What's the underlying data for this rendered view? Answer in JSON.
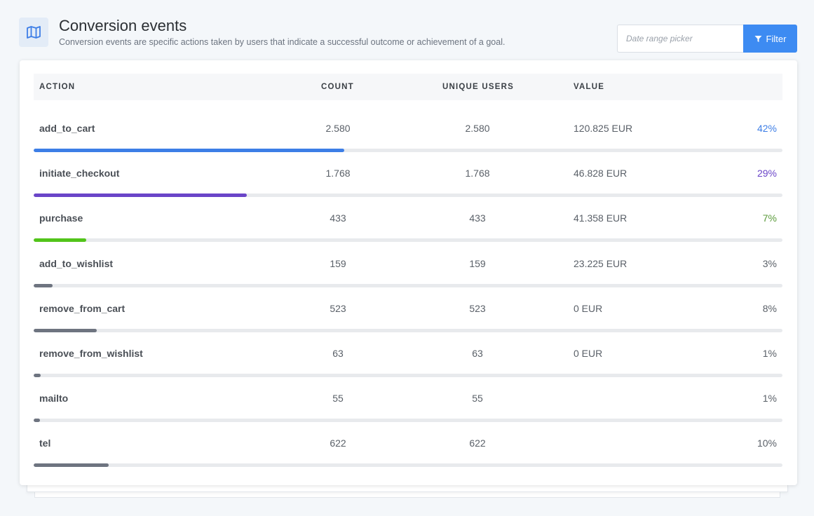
{
  "header": {
    "icon": "map-icon",
    "title": "Conversion events",
    "subtitle": "Conversion events are specific actions taken by users that indicate a successful outcome or achievement of a goal."
  },
  "toolbar": {
    "date_placeholder": "Date range picker",
    "filter_icon": "funnel-icon",
    "filter_label": "Filter",
    "accent_color": "#3d8bf2"
  },
  "table": {
    "columns": {
      "action": "ACTION",
      "count": "COUNT",
      "unique_users": "UNIQUE USERS",
      "value": "VALUE"
    },
    "rows": [
      {
        "action": "add_to_cart",
        "count": "2.580",
        "unique_users": "2.580",
        "value": "120.825 EUR",
        "percent": "42%",
        "share": 0.415,
        "color": "#3d7ee6",
        "percent_color": "#3d7ee6"
      },
      {
        "action": "initiate_checkout",
        "count": "1.768",
        "unique_users": "1.768",
        "value": "46.828 EUR",
        "percent": "29%",
        "share": 0.285,
        "color": "#6a45c8",
        "percent_color": "#6a45c8"
      },
      {
        "action": "purchase",
        "count": "433",
        "unique_users": "433",
        "value": "41.358 EUR",
        "percent": "7%",
        "share": 0.07,
        "color": "#52c41a",
        "percent_color": "#5a9a3a"
      },
      {
        "action": "add_to_wishlist",
        "count": "159",
        "unique_users": "159",
        "value": "23.225 EUR",
        "percent": "3%",
        "share": 0.025,
        "color": "#6e7480",
        "percent_color": "#5a6068"
      },
      {
        "action": "remove_from_cart",
        "count": "523",
        "unique_users": "523",
        "value": "0 EUR",
        "percent": "8%",
        "share": 0.084,
        "color": "#6e7480",
        "percent_color": "#5a6068"
      },
      {
        "action": "remove_from_wishlist",
        "count": "63",
        "unique_users": "63",
        "value": "0 EUR",
        "percent": "1%",
        "share": 0.009,
        "color": "#6e7480",
        "percent_color": "#5a6068"
      },
      {
        "action": "mailto",
        "count": "55",
        "unique_users": "55",
        "value": "",
        "percent": "1%",
        "share": 0.008,
        "color": "#6e7480",
        "percent_color": "#5a6068"
      },
      {
        "action": "tel",
        "count": "622",
        "unique_users": "622",
        "value": "",
        "percent": "10%",
        "share": 0.1,
        "color": "#6e7480",
        "percent_color": "#5a6068"
      }
    ]
  }
}
